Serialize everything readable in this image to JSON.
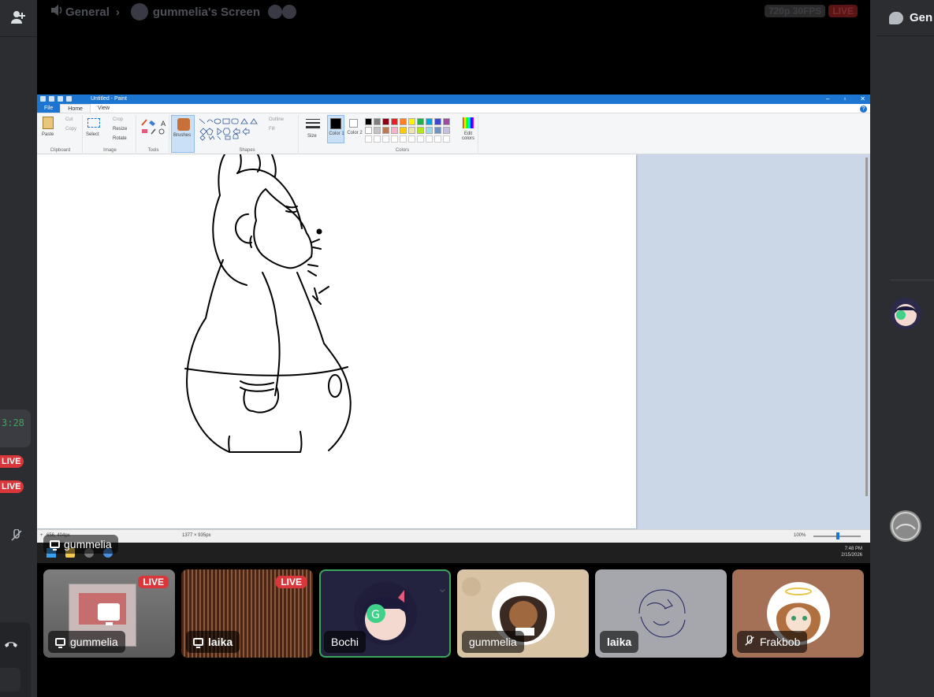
{
  "header": {
    "channel": "General",
    "stream_title": "gummelia's Screen",
    "quality": "720p 30FPS",
    "live": "LIVE"
  },
  "left_rail": {
    "timer": "3:28",
    "live_badges": [
      "LIVE",
      "LIVE"
    ]
  },
  "right_rail": {
    "chat_label": "Gen"
  },
  "paint": {
    "title": "Untitled - Paint",
    "tabs": [
      "File",
      "Home",
      "View"
    ],
    "clipboard": {
      "paste": "Paste",
      "cut": "Cut",
      "copy": "Copy",
      "label": "Clipboard"
    },
    "image": {
      "select": "Select",
      "crop": "Crop",
      "resize": "Resize",
      "rotate": "Rotate",
      "label": "Image"
    },
    "tools_label": "Tools",
    "brushes": "Brushes",
    "shapes": {
      "outline": "Outline",
      "fill": "Fill",
      "label": "Shapes"
    },
    "size": "Size",
    "color1": "Color 1",
    "color2": "Color 2",
    "edit_colors": "Edit colors",
    "colors_label": "Colors",
    "palette": [
      "#000000",
      "#7f7f7f",
      "#880015",
      "#ed1c24",
      "#ff7f27",
      "#fff200",
      "#22b14c",
      "#00a2e8",
      "#3f48cc",
      "#a349a4",
      "#ffffff",
      "#c3c3c3",
      "#b97a57",
      "#ffaec9",
      "#ffc90e",
      "#efe4b0",
      "#b5e61d",
      "#99d9ea",
      "#7092be",
      "#c8bfe7"
    ],
    "status": {
      "cursor": "656, 404px",
      "dimensions": "1377 × 935px",
      "zoom": "100%"
    },
    "clock": {
      "time": "7:48 PM",
      "date": "2/15/2026"
    }
  },
  "stream_user": "gummelia",
  "tiles": [
    {
      "name": "gummelia",
      "live": "LIVE",
      "kind": "stream",
      "bg": "#6b6b6b"
    },
    {
      "name": "laika",
      "live": "LIVE",
      "kind": "stream",
      "bg": "#5a2e1a"
    },
    {
      "name": "Bochi",
      "kind": "avatar",
      "bg": "#23233f"
    },
    {
      "name": "gummelia",
      "kind": "avatar",
      "bg": "#d8c3a5"
    },
    {
      "name": "laika",
      "kind": "avatar",
      "bg": "#a6a7ad"
    },
    {
      "name": "Frakbob",
      "kind": "avatar",
      "bg": "#a47157"
    }
  ],
  "icons": [
    "add-friend-icon",
    "speaker-icon",
    "chat-bubble-icon",
    "mute-icon",
    "hangup-icon",
    "screen-share-icon"
  ]
}
